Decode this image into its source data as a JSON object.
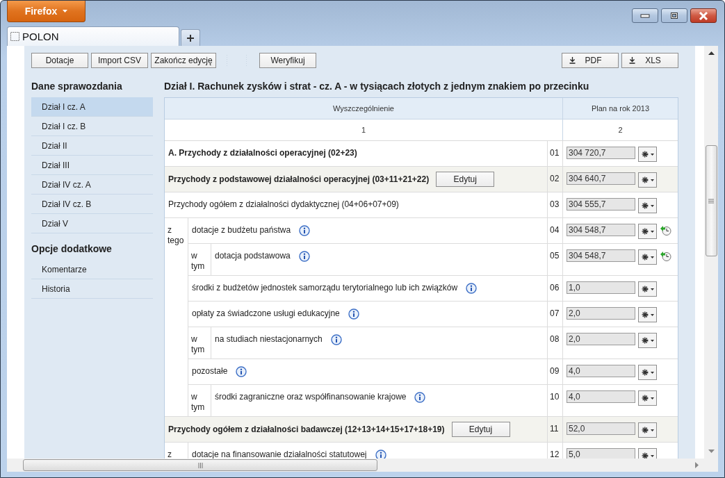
{
  "window": {
    "app_button": "Firefox"
  },
  "tabs": [
    {
      "title": "POLON"
    }
  ],
  "toolbar": {
    "left_buttons": [
      "Dotacje",
      "Import CSV",
      "Zakończ edycję"
    ],
    "verify_button": "Weryfikuj",
    "export_buttons": [
      "PDF",
      "XLS"
    ]
  },
  "sidebar": {
    "sections": [
      {
        "title": "Dane sprawozdania",
        "items": [
          {
            "label": "Dział I cz. A",
            "selected": true
          },
          {
            "label": "Dział I cz. B",
            "selected": false
          },
          {
            "label": "Dział II",
            "selected": false
          },
          {
            "label": "Dział III",
            "selected": false
          },
          {
            "label": "Dział IV cz. A",
            "selected": false
          },
          {
            "label": "Dział IV cz. B",
            "selected": false
          },
          {
            "label": "Dział V",
            "selected": false
          }
        ]
      },
      {
        "title": "Opcje dodatkowe",
        "items": [
          {
            "label": "Komentarze",
            "selected": false
          },
          {
            "label": "Historia",
            "selected": false
          }
        ]
      }
    ]
  },
  "report": {
    "title": "Dział I. Rachunek zysków i strat - cz. A - w tysiącach złotych z jednym znakiem po przecinku",
    "columns": [
      {
        "label": "Wyszczególnienie",
        "number": "1"
      },
      {
        "label": "Plan na rok 2013",
        "number": "2"
      }
    ],
    "rows": [
      {
        "kind": "section",
        "label": "A. Przychody z działalności operacyjnej (02+23)",
        "code": "01",
        "value": "304 720,7"
      },
      {
        "kind": "subtotal",
        "label": "Przychody z podstawowej działalności operacyjnej (03+11+21+22)",
        "button": "Edytuj",
        "code": "02",
        "value": "304 640,7"
      },
      {
        "kind": "item",
        "label": "Przychody ogółem z działalności dydaktycznej (04+06+07+09)",
        "code": "03",
        "value": "304 555,7",
        "info": false,
        "history": false
      },
      {
        "kind": "group",
        "prefix": "z tego",
        "children": [
          {
            "kind": "item",
            "label": "dotacje z budżetu państwa",
            "code": "04",
            "value": "304 548,7",
            "info": true,
            "history": true
          },
          {
            "kind": "group",
            "prefix": "w tym",
            "children": [
              {
                "kind": "item",
                "label": "dotacja podstawowa",
                "code": "05",
                "value": "304 548,7",
                "info": true,
                "history": true
              }
            ]
          },
          {
            "kind": "item",
            "label": "środki z budżetów jednostek samorządu terytorialnego lub ich związków",
            "code": "06",
            "value": "1,0",
            "info": true,
            "history": false
          },
          {
            "kind": "item",
            "label": "opłaty za świadczone usługi edukacyjne",
            "code": "07",
            "value": "2,0",
            "info": true,
            "history": false
          },
          {
            "kind": "group",
            "prefix": "w tym",
            "children": [
              {
                "kind": "item",
                "label": "na studiach niestacjonarnych",
                "code": "08",
                "value": "2,0",
                "info": true,
                "history": false
              }
            ]
          },
          {
            "kind": "item",
            "label": "pozostałe",
            "code": "09",
            "value": "4,0",
            "info": true,
            "history": false
          },
          {
            "kind": "group",
            "prefix": "w tym",
            "children": [
              {
                "kind": "item",
                "label": "środki zagraniczne oraz współfinansowanie krajowe",
                "code": "10",
                "value": "4,0",
                "info": true,
                "history": false
              }
            ]
          }
        ]
      },
      {
        "kind": "subtotal",
        "label": "Przychody ogółem z działalności badawczej (12+13+14+15+17+18+19)",
        "button": "Edytuj",
        "code": "11",
        "value": "52,0"
      },
      {
        "kind": "group",
        "prefix": "z",
        "children": [
          {
            "kind": "item",
            "label": "dotacje na finansowanie działalności statutowej",
            "code": "12",
            "value": "5,0",
            "info": true,
            "history": false
          }
        ]
      }
    ]
  }
}
